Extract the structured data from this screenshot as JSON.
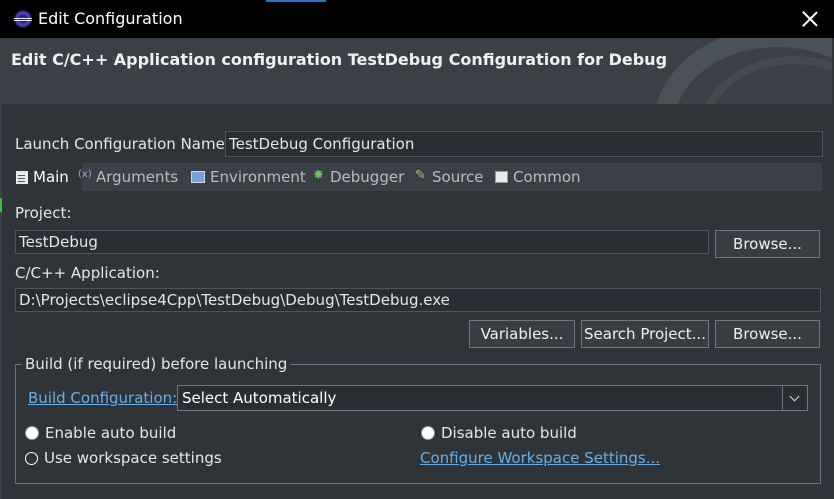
{
  "window": {
    "title": "Edit Configuration"
  },
  "header": {
    "title": "Edit C/C++ Application configuration TestDebug Configuration for Debug"
  },
  "launch_config": {
    "label": "Launch Configuration Name:",
    "value": "TestDebug Configuration"
  },
  "tabs": [
    {
      "label": "Main",
      "icon": "document-icon"
    },
    {
      "label": "Arguments",
      "icon": "arguments-icon"
    },
    {
      "label": "Environment",
      "icon": "environment-icon"
    },
    {
      "label": "Debugger",
      "icon": "debugger-icon"
    },
    {
      "label": "Source",
      "icon": "source-icon"
    },
    {
      "label": "Common",
      "icon": "common-icon"
    }
  ],
  "main": {
    "project_label": "Project:",
    "project_value": "TestDebug",
    "browse_label": "Browse...",
    "app_label": "C/C++ Application:",
    "app_value": "D:\\Projects\\eclipse4Cpp\\TestDebug\\Debug\\TestDebug.exe",
    "variables_label": "Variables...",
    "search_project_label": "Search Project...",
    "browse2_label": "Browse..."
  },
  "build": {
    "group_title": "Build (if required) before launching",
    "config_link": "Build Configuration:",
    "config_selected": "Select Automatically",
    "enable_auto": "Enable auto build",
    "disable_auto": "Disable auto build",
    "use_workspace": "Use workspace settings",
    "configure_link": "Configure Workspace Settings...",
    "selected_radio": "use_workspace"
  },
  "colors": {
    "background": "#2f3438",
    "title_bar": "#000000",
    "link": "#6aaee8",
    "accent": "#2f6dc8"
  }
}
